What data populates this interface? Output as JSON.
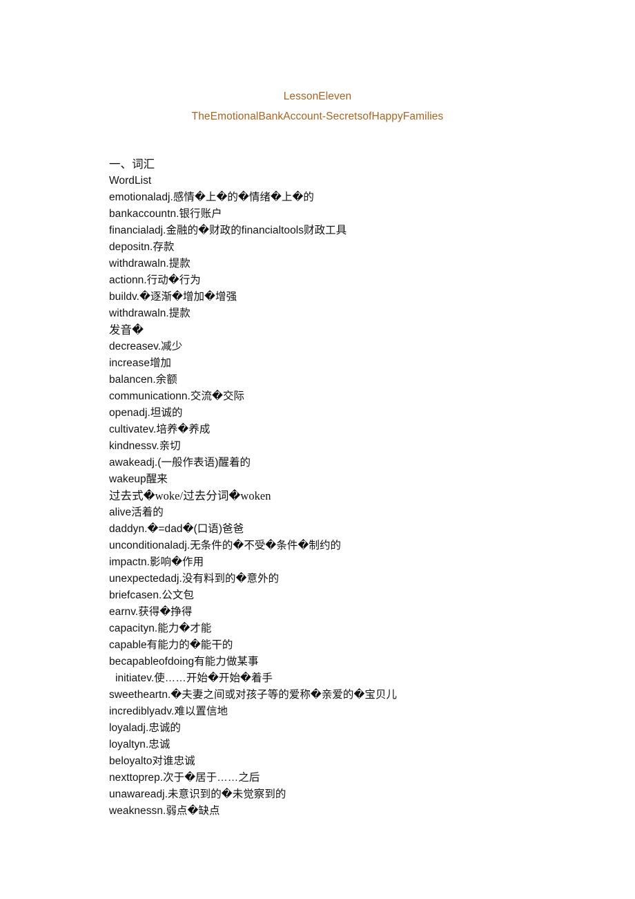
{
  "document": {
    "title_lines": [
      "LessonEleven",
      "TheEmotionalBankAccount-SecretsofHappyFamilies"
    ],
    "title_color": "#a9641e",
    "body_color": "#121212",
    "section_heading_cn": "一、词汇",
    "section_heading_en": "WordList"
  },
  "word_list": [
    {
      "text": "一、词汇",
      "cjk_lead": true,
      "indent": false
    },
    {
      "text": "WordList",
      "cjk_lead": false,
      "indent": false
    },
    {
      "text": "emotionaladj.感情�上�的�情绪�上�的",
      "cjk_lead": false,
      "indent": false
    },
    {
      "text": "bankaccountn.银行账户",
      "cjk_lead": false,
      "indent": false
    },
    {
      "text": "financialadj.金融的�财政的financialtools财政工具",
      "cjk_lead": false,
      "indent": false
    },
    {
      "text": "depositn.存款",
      "cjk_lead": false,
      "indent": false
    },
    {
      "text": "withdrawaln.提款",
      "cjk_lead": false,
      "indent": false
    },
    {
      "text": "actionn.行动�行为",
      "cjk_lead": false,
      "indent": false
    },
    {
      "text": "buildv.�逐渐�增加�增强",
      "cjk_lead": false,
      "indent": false
    },
    {
      "text": "withdrawaln.提款",
      "cjk_lead": false,
      "indent": false
    },
    {
      "text": "发音�",
      "cjk_lead": true,
      "indent": false
    },
    {
      "text": "decreasev.减少",
      "cjk_lead": false,
      "indent": false
    },
    {
      "text": "increase增加",
      "cjk_lead": false,
      "indent": false
    },
    {
      "text": "balancen.余额",
      "cjk_lead": false,
      "indent": false
    },
    {
      "text": "communicationn.交流�交际",
      "cjk_lead": false,
      "indent": false
    },
    {
      "text": "openadj.坦诚的",
      "cjk_lead": false,
      "indent": false
    },
    {
      "text": "cultivatev.培养�养成",
      "cjk_lead": false,
      "indent": false
    },
    {
      "text": "kindnessv.亲切",
      "cjk_lead": false,
      "indent": false
    },
    {
      "text": "awakeadj.(一般作表语)醒着的",
      "cjk_lead": false,
      "indent": false
    },
    {
      "text": "wakeup醒来",
      "cjk_lead": false,
      "indent": false
    },
    {
      "text": "过去式�woke/过去分词�woken",
      "cjk_lead": true,
      "indent": false
    },
    {
      "text": "alive活着的",
      "cjk_lead": false,
      "indent": false
    },
    {
      "text": "daddyn.�=dad�(口语)爸爸",
      "cjk_lead": false,
      "indent": false
    },
    {
      "text": "unconditionaladj.无条件的�不受�条件�制约的",
      "cjk_lead": false,
      "indent": false
    },
    {
      "text": "impactn.影响�作用",
      "cjk_lead": false,
      "indent": false
    },
    {
      "text": "unexpectedadj.没有料到的�意外的",
      "cjk_lead": false,
      "indent": false
    },
    {
      "text": "briefcasen.公文包",
      "cjk_lead": false,
      "indent": false
    },
    {
      "text": "earnv.获得�挣得",
      "cjk_lead": false,
      "indent": false
    },
    {
      "text": "capacityn.能力�才能",
      "cjk_lead": false,
      "indent": false
    },
    {
      "text": "capable有能力的�能干的",
      "cjk_lead": false,
      "indent": false
    },
    {
      "text": "becapableofdoing有能力做某事",
      "cjk_lead": false,
      "indent": false
    },
    {
      "text": "initiatev.使……开始�开始�着手",
      "cjk_lead": false,
      "indent": true
    },
    {
      "text": "sweetheartn.�夫妻之间或对孩子等的爱称�亲爱的�宝贝儿",
      "cjk_lead": false,
      "indent": false
    },
    {
      "text": "incrediblyadv.难以置信地",
      "cjk_lead": false,
      "indent": false
    },
    {
      "text": "loyaladj.忠诚的",
      "cjk_lead": false,
      "indent": false
    },
    {
      "text": "loyaltyn.忠诚",
      "cjk_lead": false,
      "indent": false
    },
    {
      "text": "beloyalto对谁忠诚",
      "cjk_lead": false,
      "indent": false
    },
    {
      "text": "nexttoprep.次于�居于……之后",
      "cjk_lead": false,
      "indent": false
    },
    {
      "text": "unawareadj.未意识到的�未觉察到的",
      "cjk_lead": false,
      "indent": false
    },
    {
      "text": "weaknessn.弱点�缺点",
      "cjk_lead": false,
      "indent": false
    }
  ]
}
